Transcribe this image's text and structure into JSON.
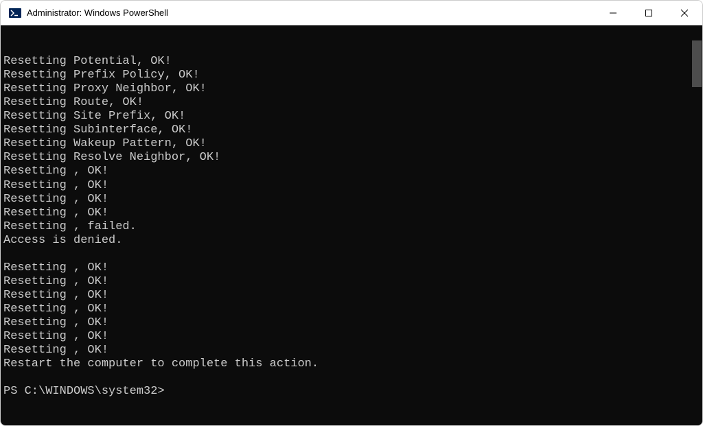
{
  "window": {
    "title": "Administrator: Windows PowerShell"
  },
  "terminal": {
    "lines": [
      "Resetting Potential, OK!",
      "Resetting Prefix Policy, OK!",
      "Resetting Proxy Neighbor, OK!",
      "Resetting Route, OK!",
      "Resetting Site Prefix, OK!",
      "Resetting Subinterface, OK!",
      "Resetting Wakeup Pattern, OK!",
      "Resetting Resolve Neighbor, OK!",
      "Resetting , OK!",
      "Resetting , OK!",
      "Resetting , OK!",
      "Resetting , OK!",
      "Resetting , failed.",
      "Access is denied.",
      "",
      "Resetting , OK!",
      "Resetting , OK!",
      "Resetting , OK!",
      "Resetting , OK!",
      "Resetting , OK!",
      "Resetting , OK!",
      "Resetting , OK!",
      "Restart the computer to complete this action.",
      ""
    ],
    "prompt": "PS C:\\WINDOWS\\system32>"
  }
}
